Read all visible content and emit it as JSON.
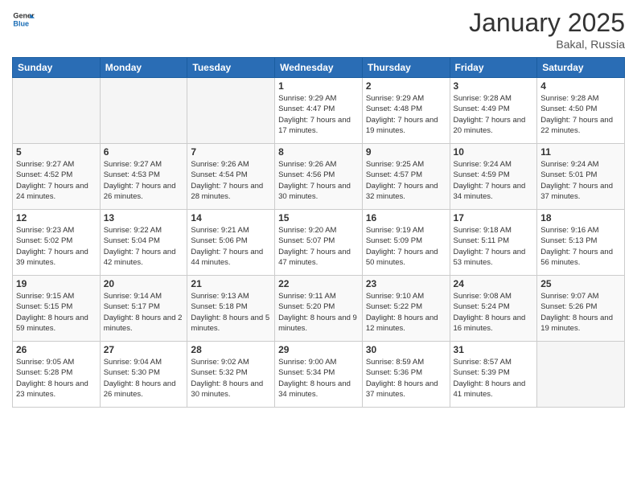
{
  "header": {
    "logo": {
      "general": "General",
      "blue": "Blue"
    },
    "title": "January 2025",
    "location": "Bakal, Russia"
  },
  "weekdays": [
    "Sunday",
    "Monday",
    "Tuesday",
    "Wednesday",
    "Thursday",
    "Friday",
    "Saturday"
  ],
  "weeks": [
    [
      {
        "day": "",
        "empty": true
      },
      {
        "day": "",
        "empty": true
      },
      {
        "day": "",
        "empty": true
      },
      {
        "day": "1",
        "sunrise": "9:29 AM",
        "sunset": "4:47 PM",
        "daylight": "7 hours and 17 minutes."
      },
      {
        "day": "2",
        "sunrise": "9:29 AM",
        "sunset": "4:48 PM",
        "daylight": "7 hours and 19 minutes."
      },
      {
        "day": "3",
        "sunrise": "9:28 AM",
        "sunset": "4:49 PM",
        "daylight": "7 hours and 20 minutes."
      },
      {
        "day": "4",
        "sunrise": "9:28 AM",
        "sunset": "4:50 PM",
        "daylight": "7 hours and 22 minutes."
      }
    ],
    [
      {
        "day": "5",
        "sunrise": "9:27 AM",
        "sunset": "4:52 PM",
        "daylight": "7 hours and 24 minutes."
      },
      {
        "day": "6",
        "sunrise": "9:27 AM",
        "sunset": "4:53 PM",
        "daylight": "7 hours and 26 minutes."
      },
      {
        "day": "7",
        "sunrise": "9:26 AM",
        "sunset": "4:54 PM",
        "daylight": "7 hours and 28 minutes."
      },
      {
        "day": "8",
        "sunrise": "9:26 AM",
        "sunset": "4:56 PM",
        "daylight": "7 hours and 30 minutes."
      },
      {
        "day": "9",
        "sunrise": "9:25 AM",
        "sunset": "4:57 PM",
        "daylight": "7 hours and 32 minutes."
      },
      {
        "day": "10",
        "sunrise": "9:24 AM",
        "sunset": "4:59 PM",
        "daylight": "7 hours and 34 minutes."
      },
      {
        "day": "11",
        "sunrise": "9:24 AM",
        "sunset": "5:01 PM",
        "daylight": "7 hours and 37 minutes."
      }
    ],
    [
      {
        "day": "12",
        "sunrise": "9:23 AM",
        "sunset": "5:02 PM",
        "daylight": "7 hours and 39 minutes."
      },
      {
        "day": "13",
        "sunrise": "9:22 AM",
        "sunset": "5:04 PM",
        "daylight": "7 hours and 42 minutes."
      },
      {
        "day": "14",
        "sunrise": "9:21 AM",
        "sunset": "5:06 PM",
        "daylight": "7 hours and 44 minutes."
      },
      {
        "day": "15",
        "sunrise": "9:20 AM",
        "sunset": "5:07 PM",
        "daylight": "7 hours and 47 minutes."
      },
      {
        "day": "16",
        "sunrise": "9:19 AM",
        "sunset": "5:09 PM",
        "daylight": "7 hours and 50 minutes."
      },
      {
        "day": "17",
        "sunrise": "9:18 AM",
        "sunset": "5:11 PM",
        "daylight": "7 hours and 53 minutes."
      },
      {
        "day": "18",
        "sunrise": "9:16 AM",
        "sunset": "5:13 PM",
        "daylight": "7 hours and 56 minutes."
      }
    ],
    [
      {
        "day": "19",
        "sunrise": "9:15 AM",
        "sunset": "5:15 PM",
        "daylight": "8 hours and 59 minutes."
      },
      {
        "day": "20",
        "sunrise": "9:14 AM",
        "sunset": "5:17 PM",
        "daylight": "8 hours and 2 minutes."
      },
      {
        "day": "21",
        "sunrise": "9:13 AM",
        "sunset": "5:18 PM",
        "daylight": "8 hours and 5 minutes."
      },
      {
        "day": "22",
        "sunrise": "9:11 AM",
        "sunset": "5:20 PM",
        "daylight": "8 hours and 9 minutes."
      },
      {
        "day": "23",
        "sunrise": "9:10 AM",
        "sunset": "5:22 PM",
        "daylight": "8 hours and 12 minutes."
      },
      {
        "day": "24",
        "sunrise": "9:08 AM",
        "sunset": "5:24 PM",
        "daylight": "8 hours and 16 minutes."
      },
      {
        "day": "25",
        "sunrise": "9:07 AM",
        "sunset": "5:26 PM",
        "daylight": "8 hours and 19 minutes."
      }
    ],
    [
      {
        "day": "26",
        "sunrise": "9:05 AM",
        "sunset": "5:28 PM",
        "daylight": "8 hours and 23 minutes."
      },
      {
        "day": "27",
        "sunrise": "9:04 AM",
        "sunset": "5:30 PM",
        "daylight": "8 hours and 26 minutes."
      },
      {
        "day": "28",
        "sunrise": "9:02 AM",
        "sunset": "5:32 PM",
        "daylight": "8 hours and 30 minutes."
      },
      {
        "day": "29",
        "sunrise": "9:00 AM",
        "sunset": "5:34 PM",
        "daylight": "8 hours and 34 minutes."
      },
      {
        "day": "30",
        "sunrise": "8:59 AM",
        "sunset": "5:36 PM",
        "daylight": "8 hours and 37 minutes."
      },
      {
        "day": "31",
        "sunrise": "8:57 AM",
        "sunset": "5:39 PM",
        "daylight": "8 hours and 41 minutes."
      },
      {
        "day": "",
        "empty": true
      }
    ]
  ]
}
